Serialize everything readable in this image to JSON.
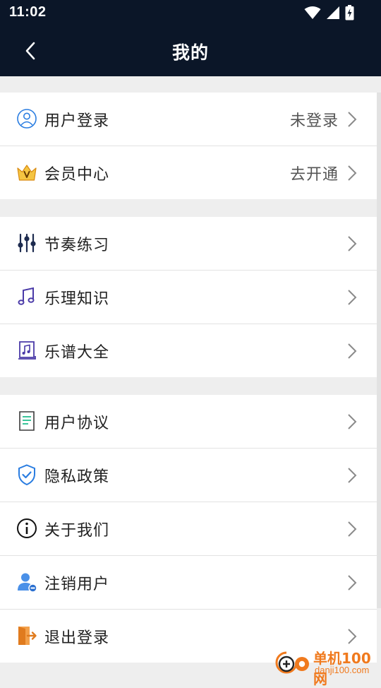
{
  "status_bar": {
    "time": "11:02",
    "icons": [
      "wifi-icon",
      "cell-signal-icon",
      "battery-charging-icon"
    ]
  },
  "app_bar": {
    "back_icon": "chevron-left-icon",
    "title": "我的"
  },
  "sections": [
    {
      "items": [
        {
          "label": "用户登录",
          "value": "未登录",
          "icon": "user-circle-icon"
        },
        {
          "label": "会员中心",
          "value": "去开通",
          "icon": "vip-crown-icon"
        }
      ]
    },
    {
      "items": [
        {
          "label": "节奏练习",
          "icon": "sliders-icon"
        },
        {
          "label": "乐理知识",
          "icon": "music-note-icon"
        },
        {
          "label": "乐谱大全",
          "icon": "music-book-icon"
        }
      ]
    },
    {
      "items": [
        {
          "label": "用户协议",
          "icon": "document-icon"
        },
        {
          "label": "隐私政策",
          "icon": "shield-check-icon"
        },
        {
          "label": "关于我们",
          "icon": "info-icon"
        },
        {
          "label": "注销用户",
          "icon": "user-remove-icon"
        },
        {
          "label": "退出登录",
          "icon": "logout-door-icon"
        }
      ]
    }
  ],
  "colors": {
    "header_bg": "#0b1628",
    "page_bg": "#eeeeee",
    "accent_purple": "#4a3aa8",
    "accent_blue": "#2a7de1",
    "accent_green": "#3bc49a",
    "accent_orange": "#f08c2c",
    "vip_gold": "#f5a623"
  },
  "watermark": {
    "cn": "单机100网",
    "en": "danji100.com"
  }
}
